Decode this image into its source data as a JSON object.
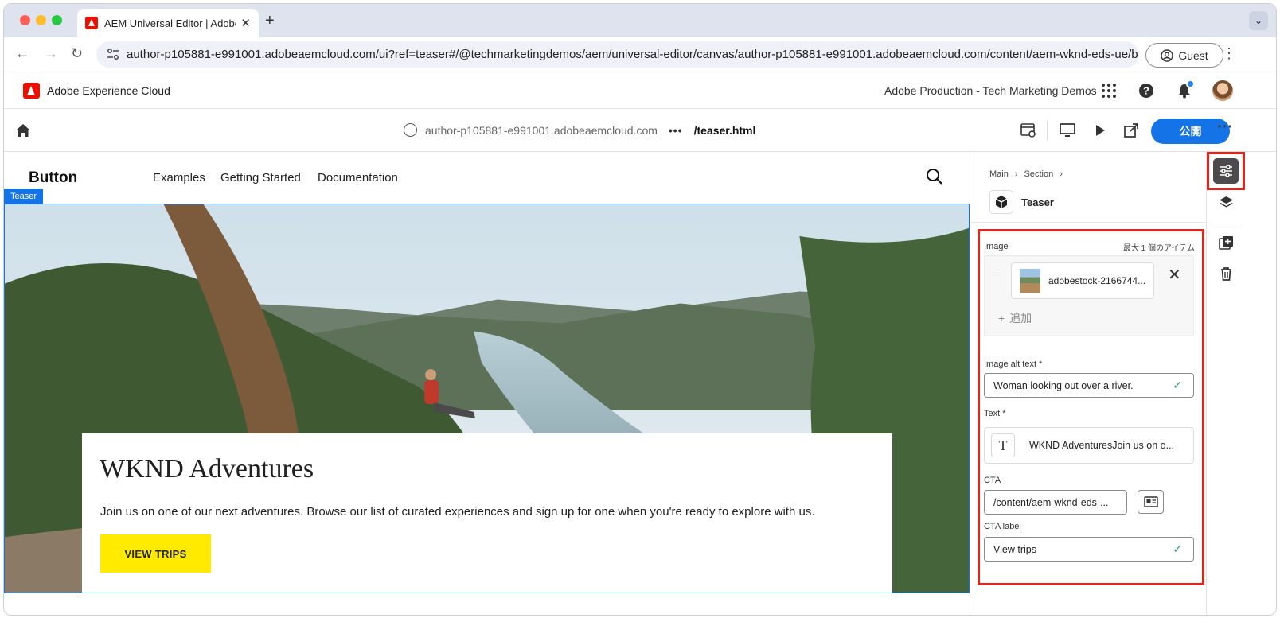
{
  "browser": {
    "tab_title": "AEM Universal Editor | Adobe",
    "url": "author-p105881-e991001.adobeaemcloud.com/ui?ref=teaser#/@techmarketingdemos/aem/universal-editor/canvas/author-p105881-e991001.adobeaemcloud.com/content/aem-wknd-eds-ue/b...",
    "profile_label": "Guest"
  },
  "shell": {
    "product_name": "Adobe Experience Cloud",
    "org_name": "Adobe Production - Tech Marketing Demos"
  },
  "editor": {
    "host": "author-p105881-e991001.adobeaemcloud.com",
    "path_dots": "•••",
    "page": "/teaser.html",
    "publish_label": "公開"
  },
  "site": {
    "brand": "Button",
    "nav": [
      "Examples",
      "Getting Started",
      "Documentation"
    ],
    "badge": "Teaser",
    "teaser": {
      "title": "WKND Adventures",
      "text": "Join us on one of our next adventures. Browse our list of curated experiences and sign up for one when you're ready to explore with us.",
      "cta": "VIEW TRIPS"
    }
  },
  "panel": {
    "breadcrumb": [
      "Main",
      "Section"
    ],
    "component": "Teaser",
    "image_label": "Image",
    "max_items": "最大 1 個のアイテム",
    "asset_name": "adobestock-2166744...",
    "add_label": "追加",
    "alt_label": "Image alt text",
    "alt_value": "Woman looking out over a river.",
    "text_label": "Text",
    "text_value": "WKND AdventuresJoin us on o...",
    "cta_label": "CTA",
    "cta_value": "/content/aem-wknd-eds-...",
    "cta_label_label": "CTA label",
    "cta_label_value": "View trips",
    "required_mark": "*"
  },
  "colors": {
    "accent": "#1473e6",
    "highlight": "#e0251b",
    "cta_yellow": "#ffea00"
  },
  "icons": [
    "home-icon",
    "globe-icon",
    "search-icon",
    "properties-icon",
    "layers-icon",
    "add-component-icon",
    "delete-icon"
  ]
}
